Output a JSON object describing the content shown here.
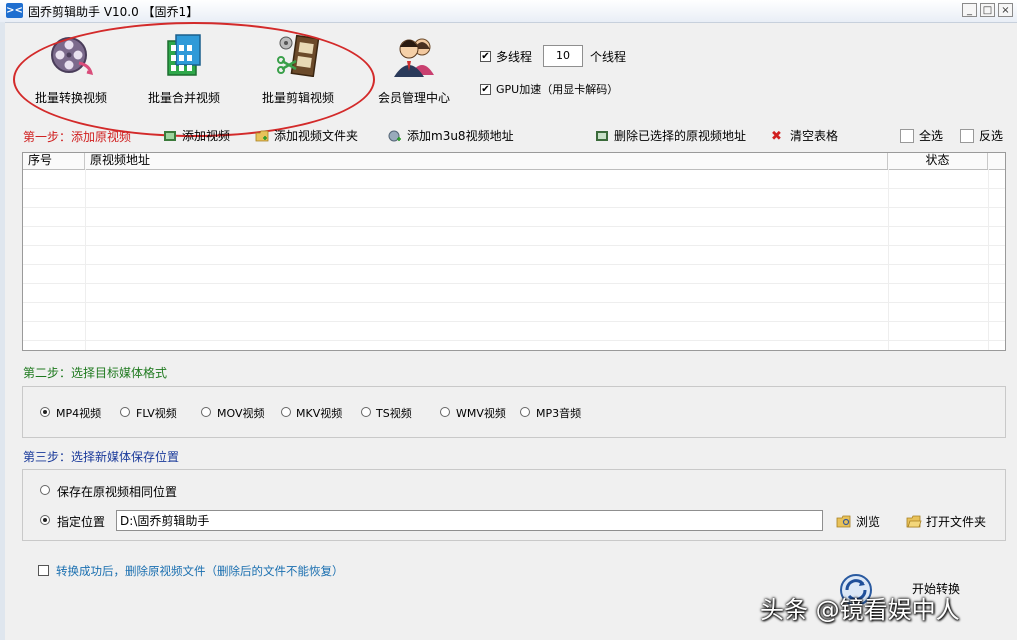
{
  "window": {
    "title": "固乔剪辑助手 V10.0 【固乔1】",
    "controls": [
      "_",
      "□",
      "×"
    ]
  },
  "big_tools": [
    {
      "label": "批量转换视频",
      "icon": "film-reel-icon"
    },
    {
      "label": "批量合并视频",
      "icon": "merge-film-icon"
    },
    {
      "label": "批量剪辑视频",
      "icon": "film-cut-icon"
    },
    {
      "label": "会员管理中心",
      "icon": "user-icon"
    }
  ],
  "options": {
    "multithread_label": "多线程",
    "multithread_checked": true,
    "thread_count": "10",
    "thread_unit": "个线程",
    "gpu_label": "GPU加速（用显卡解码）",
    "gpu_checked": true
  },
  "step1": {
    "label": "第一步：添加原视频",
    "toolbar": {
      "add_video": "添加视频",
      "add_folder": "添加视频文件夹",
      "add_m3u8": "添加m3u8视频地址",
      "delete_selected": "删除已选择的原视频地址",
      "clear_table": "清空表格",
      "select_all": "全选",
      "invert": "反选"
    },
    "columns": [
      "序号",
      "原视频地址",
      "状态"
    ]
  },
  "step2": {
    "label": "第二步：选择目标媒体格式",
    "formats": [
      "MP4视频",
      "FLV视频",
      "MOV视频",
      "MKV视频",
      "TS视频",
      "WMV视频",
      "MP3音频"
    ],
    "selected": "MP4视频"
  },
  "step3": {
    "label": "第三步：选择新媒体保存位置",
    "option_same": "保存在原视频相同位置",
    "option_custom": "指定位置",
    "selected": "指定位置",
    "path": "D:\\固乔剪辑助手",
    "browse": "浏览",
    "open_folder": "打开文件夹"
  },
  "delete_after": {
    "label": "转换成功后，删除原视频文件（删除后的文件不能恢复）",
    "checked": false
  },
  "start_label": "开始转换",
  "watermark": "头条 @镜看娱中人",
  "colors": {
    "step1": "#d02020",
    "step2": "#1f7a1f",
    "step3": "#1a3a9a",
    "delete_after": "#1a6fb0",
    "highlight": "#d32a2a"
  }
}
